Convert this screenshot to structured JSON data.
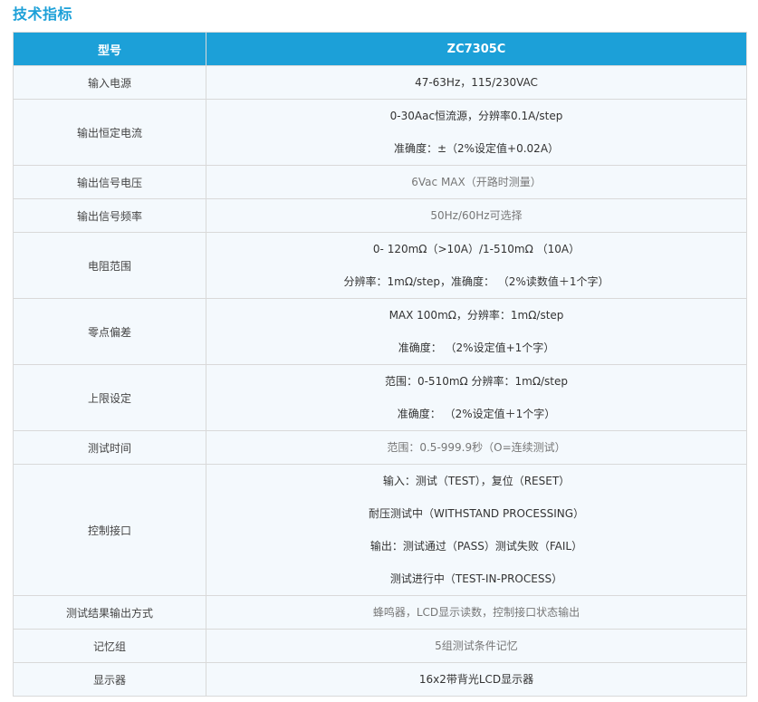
{
  "section": {
    "title": "技术指标"
  },
  "table": {
    "headers": [
      "型号",
      "ZC7305C"
    ],
    "rows": [
      {
        "param": "输入电源",
        "values": [
          "47-63Hz，115/230VAC"
        ]
      },
      {
        "param": "输出恒定电流",
        "values": [
          "0-30Aac恒流源，分辨率0.1A/step",
          "准确度：±（2%设定值+0.02A）"
        ]
      },
      {
        "param": "输出信号电压",
        "values": [
          "6Vac MAX（开路时测量）"
        ]
      },
      {
        "param": "输出信号频率",
        "values": [
          "50Hz/60Hz可选择"
        ]
      },
      {
        "param": "电阻范围",
        "values": [
          "0- 120mΩ（>10A）/1-510mΩ （10A）",
          "分辨率：1mΩ/step，准确度： （2%读数值＋1个字）"
        ]
      },
      {
        "param": "零点偏差",
        "values": [
          "MAX 100mΩ，分辨率：1mΩ/step",
          "准确度： （2%设定值+1个字）"
        ]
      },
      {
        "param": "上限设定",
        "values": [
          "范围：0-510mΩ  分辨率：1mΩ/step",
          "准确度： （2%设定值＋1个字）"
        ]
      },
      {
        "param": "测试时间",
        "values": [
          "范围：0.5-999.9秒（O=连续测试）"
        ]
      },
      {
        "param": "控制接口",
        "values": [
          "输入：测试（TEST），复位（RESET）",
          "耐压测试中（WITHSTAND PROCESSING）",
          "输出：测试通过（PASS）测试失败（FAIL）",
          "测试进行中（TEST-IN-PROCESS）"
        ]
      },
      {
        "param": "测试结果输出方式",
        "values": [
          "蜂鸣器，LCD显示读数，控制接口状态输出"
        ]
      },
      {
        "param": "记忆组",
        "values": [
          "5组测试条件记忆"
        ]
      },
      {
        "param": "显示器",
        "values": [
          "16x2带背光LCD显示器"
        ]
      }
    ]
  }
}
